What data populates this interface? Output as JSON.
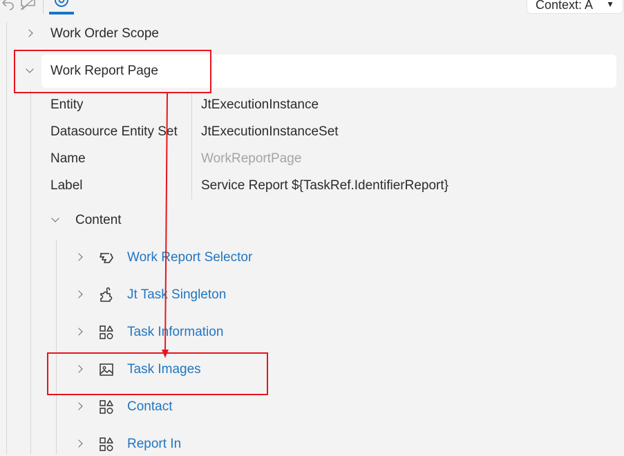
{
  "toolbar": {
    "undo_icon": "undo-icon",
    "comment_icon": "comment-icon",
    "watch_icon": "eye-icon",
    "context_label": "Context: A"
  },
  "tree": {
    "scope_label": "Work Order Scope",
    "page_label": "Work Report Page",
    "properties": [
      {
        "key": "Entity",
        "value": "JtExecutionInstance"
      },
      {
        "key": "Datasource Entity Set",
        "value": "JtExecutionInstanceSet"
      },
      {
        "key": "Name",
        "value": "WorkReportPage"
      },
      {
        "key": "Label",
        "value": "Service Report ${TaskRef.IdentifierReport}"
      }
    ],
    "content_label": "Content",
    "content_items": [
      {
        "label": "Work Report Selector",
        "icon": "hand-pointer-icon"
      },
      {
        "label": "Jt Task Singleton",
        "icon": "puzzle-icon"
      },
      {
        "label": "Task Information",
        "icon": "shapes-icon"
      },
      {
        "label": "Task Images",
        "icon": "image-icon"
      },
      {
        "label": "Contact",
        "icon": "shapes-icon"
      },
      {
        "label": "Report In",
        "icon": "shapes-icon"
      }
    ]
  },
  "colors": {
    "link": "#1f76c2",
    "highlight": "#e8141c",
    "background": "#f3f3f3"
  }
}
